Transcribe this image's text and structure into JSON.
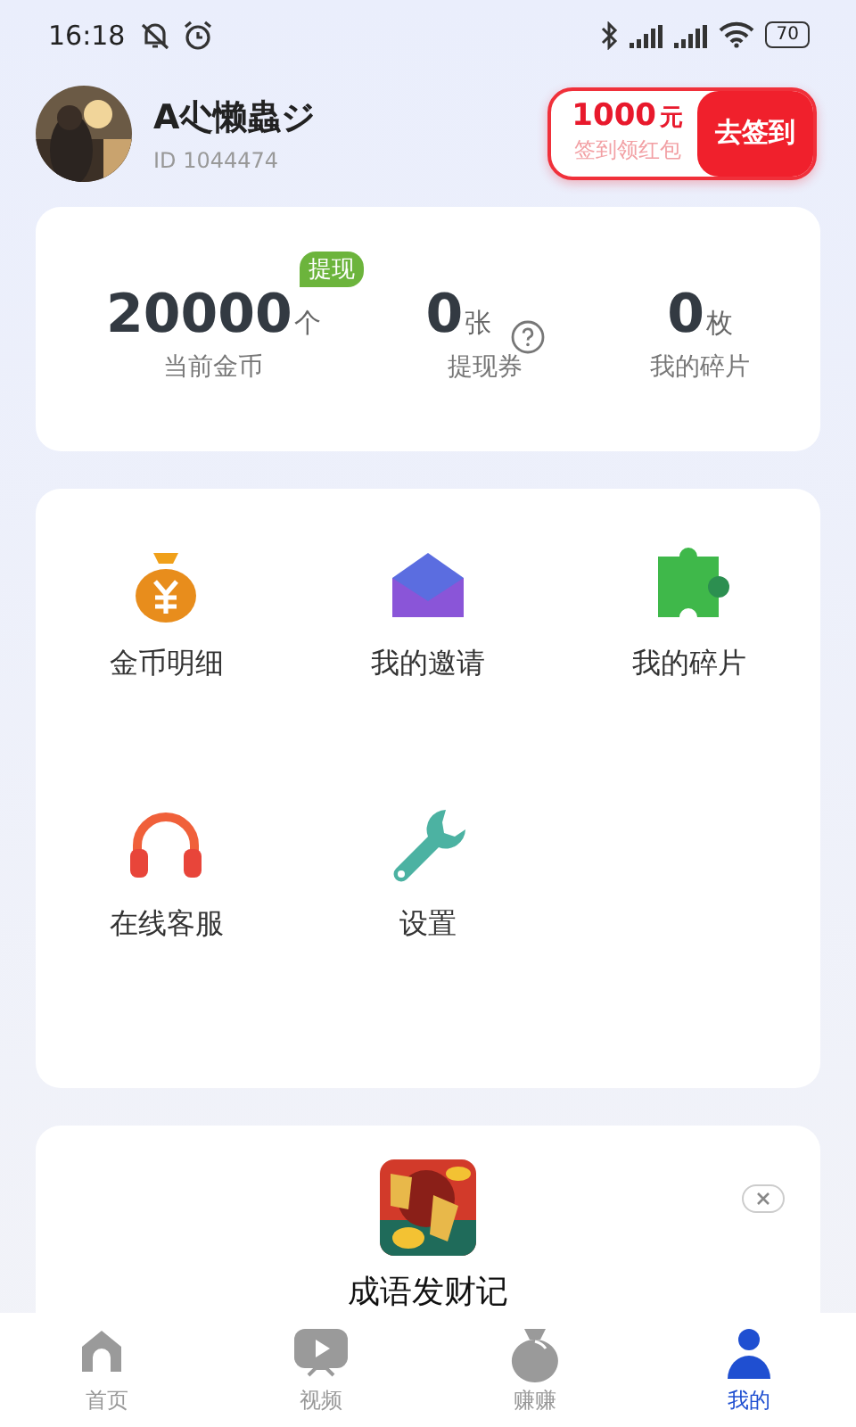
{
  "status_bar": {
    "time": "16:18",
    "battery": "70"
  },
  "profile": {
    "name": "A尐懒蟲ジ",
    "id": "ID  1044474"
  },
  "signin": {
    "amount": "1000",
    "unit": "元",
    "subtitle": "签到领红包",
    "button": "去签到"
  },
  "stats": [
    {
      "value": "20000",
      "unit": "个",
      "label": "当前金币",
      "badge": "提现",
      "help": false
    },
    {
      "value": "0",
      "unit": "张",
      "label": "提现券",
      "help": true
    },
    {
      "value": "0",
      "unit": "枚",
      "label": "我的碎片",
      "help": false
    }
  ],
  "menu": [
    {
      "label": "金币明细"
    },
    {
      "label": "我的邀请"
    },
    {
      "label": "我的碎片"
    },
    {
      "label": "在线客服"
    },
    {
      "label": "设置"
    }
  ],
  "ad": {
    "title": "成语发财记"
  },
  "tabs": [
    {
      "label": "首页",
      "selected": false
    },
    {
      "label": "视频",
      "selected": false
    },
    {
      "label": "赚赚",
      "selected": false
    },
    {
      "label": "我的",
      "selected": true
    }
  ]
}
